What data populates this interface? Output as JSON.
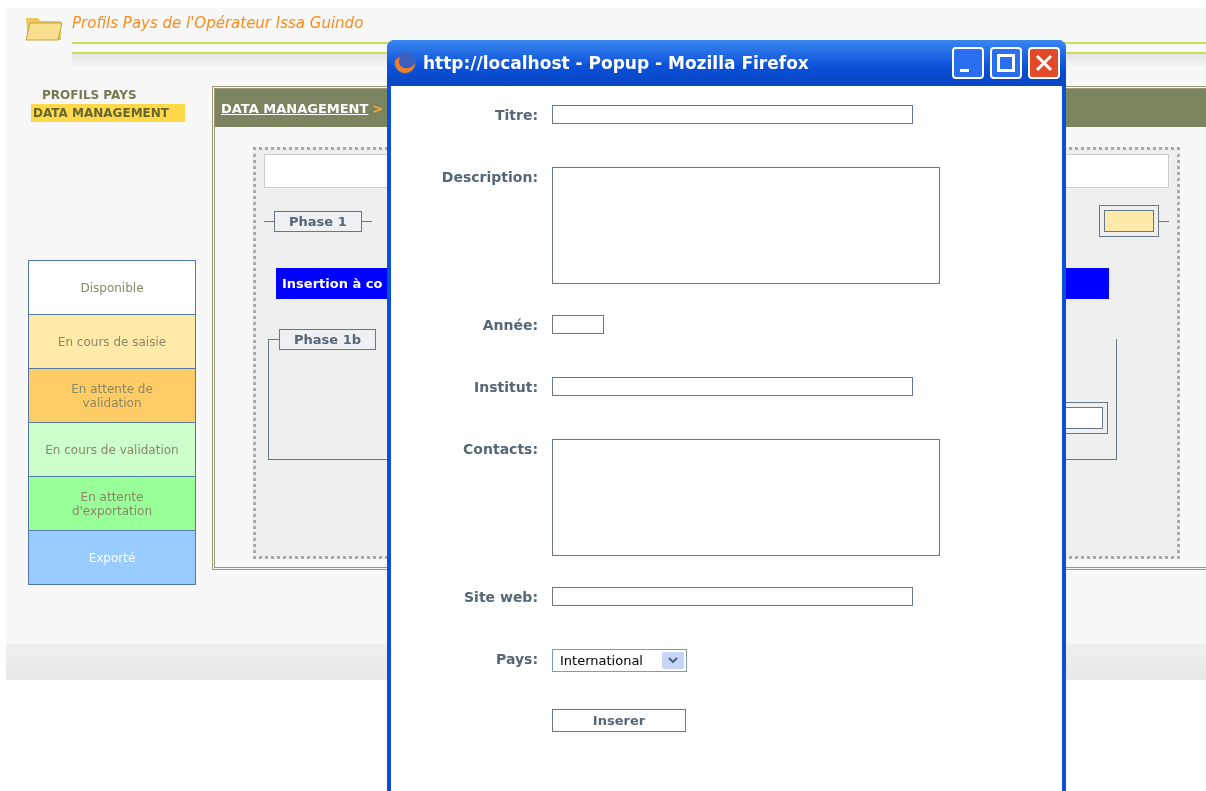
{
  "page": {
    "title": "Profils Pays de l'Opérateur Issa Guindo"
  },
  "nav": [
    {
      "label": "PROFILS PAYS",
      "selected": false
    },
    {
      "label": "DATA MANAGEMENT",
      "selected": true
    }
  ],
  "breadcrumb": {
    "link": "DATA MANAGEMENT",
    "separator": ">"
  },
  "phase_top": {
    "legend": "Phase 1"
  },
  "banner": "Insertion à co",
  "phase_bottom": {
    "legend": "Phase 1b"
  },
  "status_legend": [
    {
      "label": "Disponible",
      "color": "#ffffff"
    },
    {
      "label": "En cours de saisie",
      "color": "#ffeaaa"
    },
    {
      "label": "En attente de validation",
      "color": "#ffcc66"
    },
    {
      "label": "En cours de validation",
      "color": "#ccffcc"
    },
    {
      "label": "En attente d'exportation",
      "color": "#99ff99"
    },
    {
      "label": "Exporté",
      "color": "#99ccff"
    }
  ],
  "popup": {
    "title": "http://localhost - Popup - Mozilla Firefox",
    "fields": [
      {
        "label": "Titre:",
        "kind": "text"
      },
      {
        "label": "Description:",
        "kind": "textarea"
      },
      {
        "label": "Année:",
        "kind": "short"
      },
      {
        "label": "Institut:",
        "kind": "text"
      },
      {
        "label": "Contacts:",
        "kind": "textarea"
      },
      {
        "label": "Site web:",
        "kind": "text"
      },
      {
        "label": "Pays:",
        "kind": "select",
        "value": "International"
      }
    ],
    "submit": "Inserer"
  }
}
